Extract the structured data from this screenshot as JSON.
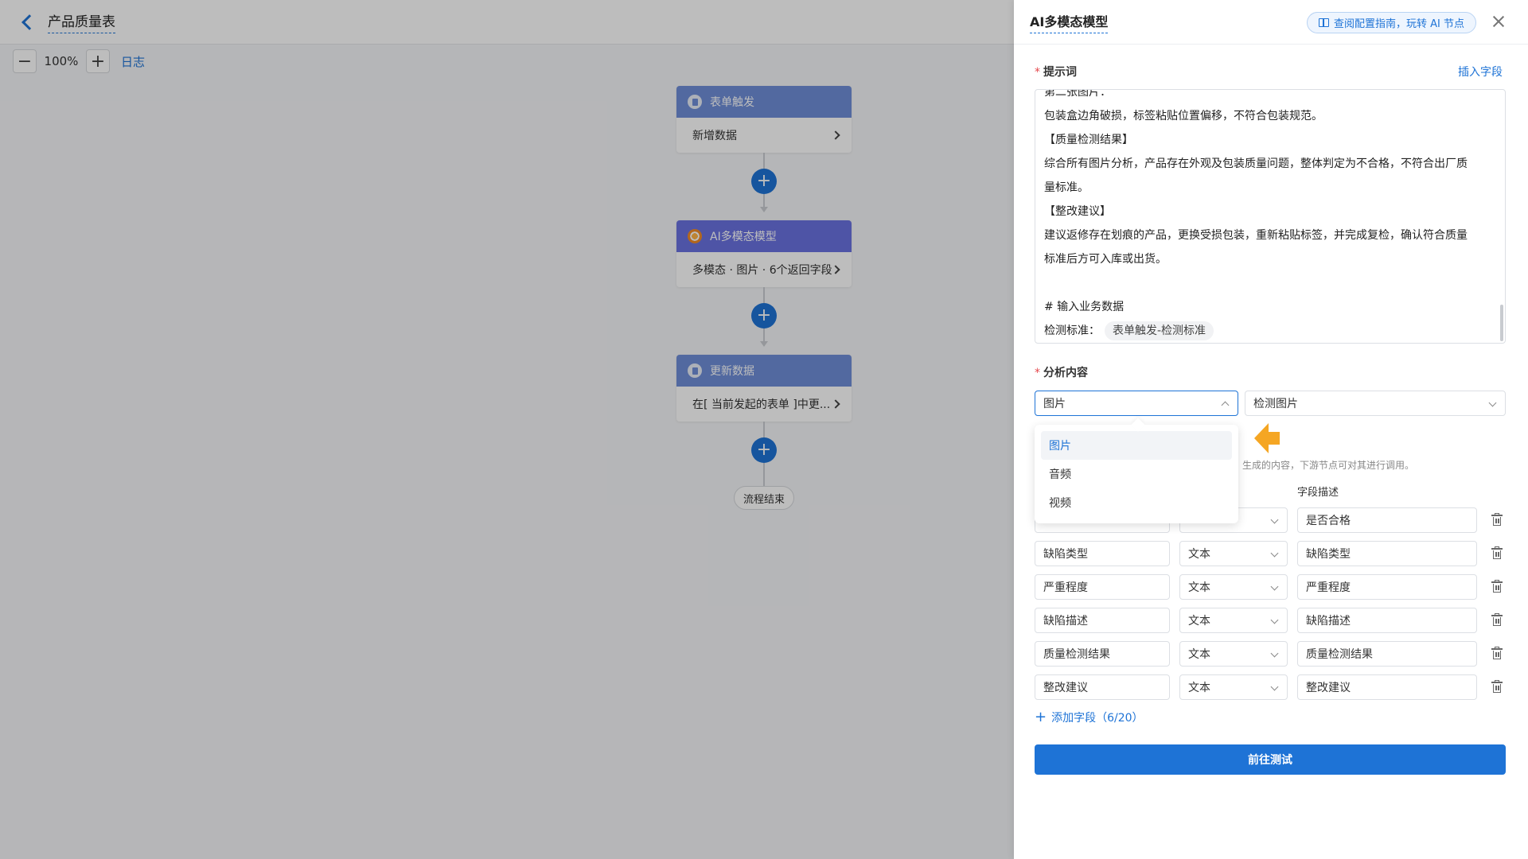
{
  "canvas": {
    "page_title": "产品质量表",
    "zoom_level": "100%",
    "log_label": "日志",
    "nodes": [
      {
        "title": "表单触发",
        "body": "新增数据"
      },
      {
        "title": "AI多模态模型",
        "body": "多模态 · 图片 · 6个返回字段"
      },
      {
        "title": "更新数据",
        "body": "在[ 当前发起的表单 ]中更..."
      }
    ],
    "end_label": "流程结束"
  },
  "panel": {
    "title": "AI多模态模型",
    "guide_label": "查阅配置指南，玩转 AI 节点",
    "prompt_label": "提示词",
    "insert_field_label": "插入字段",
    "prompt_lines": [
      "第二张图片：",
      "包装盒边角破损，标签粘贴位置偏移，不符合包装规范。",
      "【质量检测结果】",
      "综合所有图片分析，产品存在外观及包装质量问题，整体判定为不合格，不符合出厂质",
      "量标准。",
      "【整改建议】",
      "建议返修存在划痕的产品，更换受损包装，重新粘贴标签，并完成复检，确认符合质量",
      "标准后方可入库或出货。",
      "",
      "# 输入业务数据"
    ],
    "prompt_last_prefix": "检测标准：",
    "prompt_last_tag": "表单触发-检测标准",
    "analysis_label": "分析内容",
    "media_type_value": "图片",
    "media_field_value": "检测图片",
    "dropdown_options": [
      "图片",
      "音频",
      "视频"
    ],
    "hint_text": "生成的内容，下游节点可对其进行调用。",
    "col_desc_header": "字段描述",
    "fields": [
      {
        "name": "",
        "type": "",
        "desc": "是否合格"
      },
      {
        "name": "缺陷类型",
        "type": "文本",
        "desc": "缺陷类型"
      },
      {
        "name": "严重程度",
        "type": "文本",
        "desc": "严重程度"
      },
      {
        "name": "缺陷描述",
        "type": "文本",
        "desc": "缺陷描述"
      },
      {
        "name": "质量检测结果",
        "type": "文本",
        "desc": "质量检测结果"
      },
      {
        "name": "整改建议",
        "type": "文本",
        "desc": "整改建议"
      }
    ],
    "add_field_label": "添加字段（6/20）",
    "test_button_label": "前往测试"
  },
  "colors": {
    "accent": "#1e73d6",
    "node_blue": "#6f8ed8",
    "node_purple": "#6a72e0",
    "pointer_orange": "#f5a623",
    "required_red": "#e5484d"
  },
  "icons": [
    "back-chevron-icon",
    "minus-icon",
    "plus-icon",
    "form-icon",
    "ai-model-icon",
    "chevron-right-icon",
    "book-icon",
    "close-icon",
    "chevron-down-icon",
    "chevron-up-icon",
    "trash-icon",
    "arrow-left-icon"
  ]
}
